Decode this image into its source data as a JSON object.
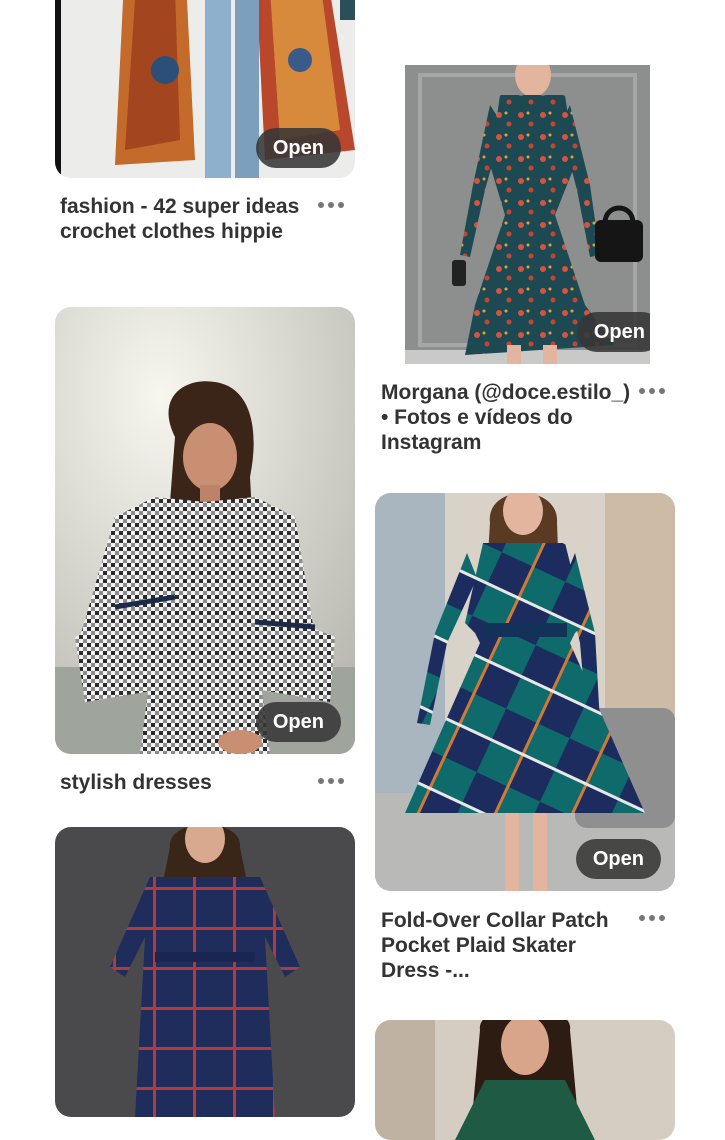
{
  "feed": {
    "open_label": "Open",
    "more_icon": "ellipsis-icon",
    "pins": [
      {
        "title": "fashion - 42 super ideas crochet clothes hippie",
        "image": "floral-kimono-jeans-photo"
      },
      {
        "title": "stylish dresses",
        "image": "gingham-bell-sleeve-dress-photo"
      },
      {
        "title": "",
        "image": "navy-plaid-dress-photo"
      },
      {
        "title": "",
        "image": "partially-visible-pin-top-right"
      },
      {
        "title": "Morgana (@doce.estilo_) • Fotos e vídeos do Instagram",
        "image": "teal-floral-shirt-dress-photo"
      },
      {
        "title": "Fold-Over Collar Patch Pocket Plaid Skater Dress -...",
        "image": "teal-plaid-skater-dress-photo"
      },
      {
        "title": "",
        "image": "green-dress-photo"
      }
    ]
  },
  "colors": {
    "background": "#ffffff",
    "text": "#333333",
    "open_button": "#373737",
    "icon_gray": "#767676"
  }
}
